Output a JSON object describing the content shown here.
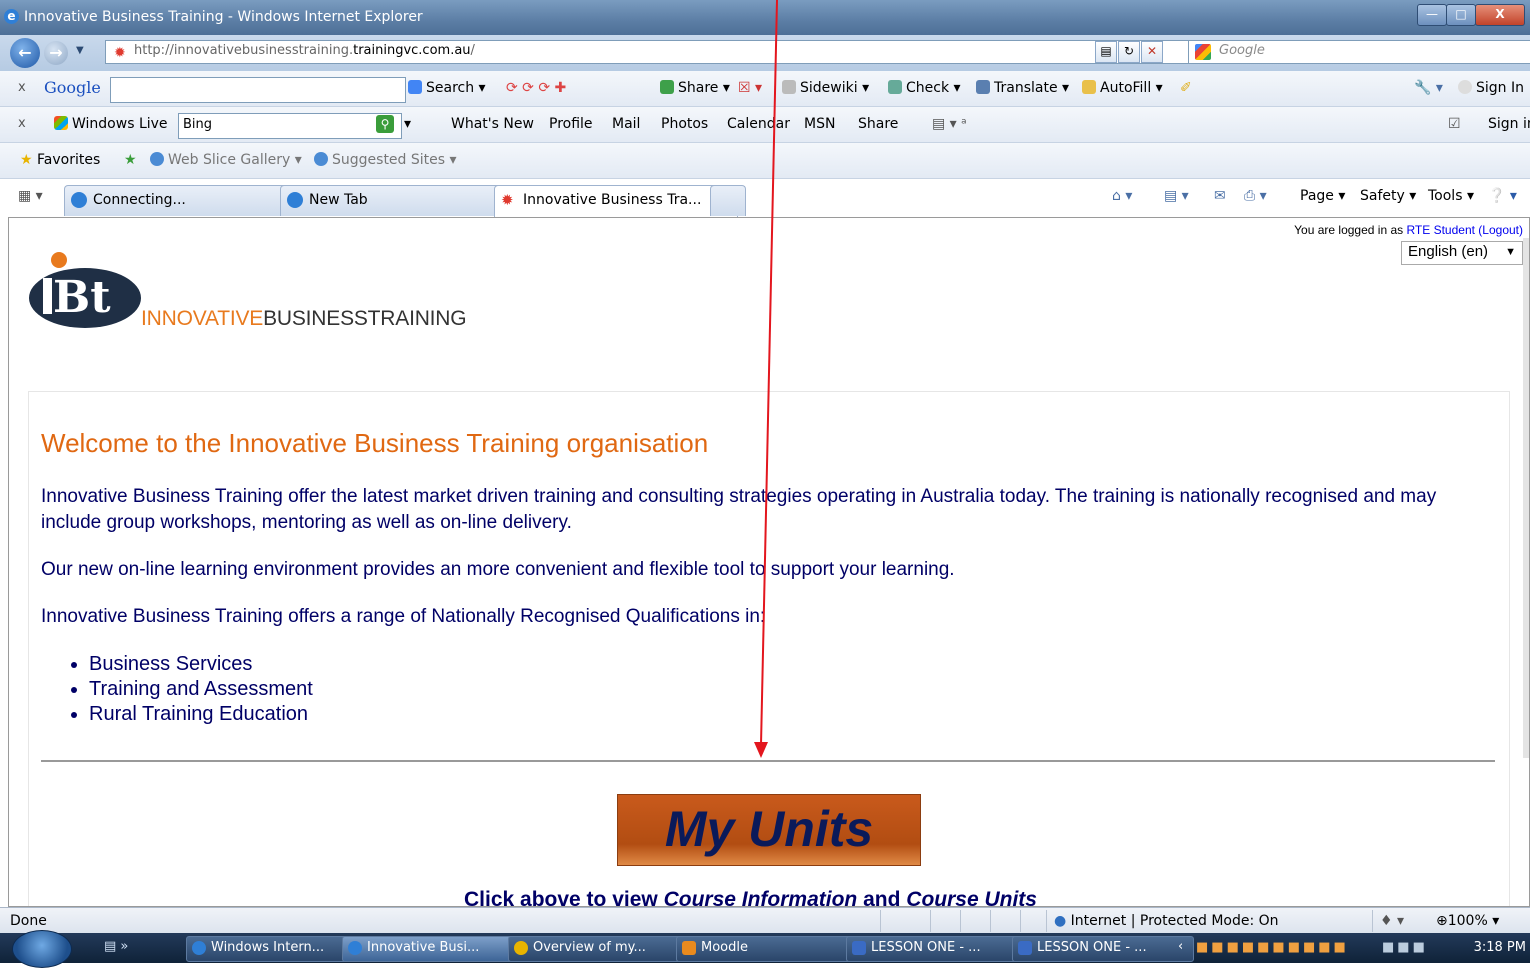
{
  "window": {
    "title": "Innovative Business Training - Windows Internet Explorer"
  },
  "address_bar": {
    "url_prefix": "http://innovativebusinesstraining.",
    "url_domain": "trainingvc.com.au",
    "url_suffix": "/",
    "search_placeholder": "Google"
  },
  "google_toolbar": {
    "close": "x",
    "logo": "Google",
    "search_value": "",
    "search_btn": "Search",
    "share": "Share",
    "sidewiki": "Sidewiki",
    "check": "Check",
    "translate": "Translate",
    "autofill": "AutoFill",
    "sign_in": "Sign In"
  },
  "live_toolbar": {
    "close": "x",
    "brand": "Windows Live",
    "search_value": "Bing",
    "links": [
      "What's New",
      "Profile",
      "Mail",
      "Photos",
      "Calendar",
      "MSN",
      "Share"
    ],
    "sign_in": "Sign in"
  },
  "favorites_bar": {
    "favorites": "Favorites",
    "web_slice": "Web Slice Gallery",
    "suggested": "Suggested Sites"
  },
  "tabs": [
    {
      "label": "Connecting..."
    },
    {
      "label": "New Tab"
    },
    {
      "label": "Innovative Business Tra..."
    }
  ],
  "command_bar": {
    "page": "Page",
    "safety": "Safety",
    "tools": "Tools"
  },
  "page": {
    "login_prefix": "You are logged in as",
    "login_user": "RTE Student",
    "logout": "(Logout)",
    "language": "English (en)",
    "logo_text_orange": "INNOVATIVE",
    "logo_text_dark": "BUSINESSTRAINING",
    "welcome": "Welcome to the Innovative Business Training organisation",
    "para1": "Innovative Business Training offer the latest market driven training and consulting strategies operating in Australia today. The training is nationally recognised and may include group workshops, mentoring as well as on-line delivery.",
    "para2": "Our new on-line learning environment provides an more convenient and flexible tool to support your learning.",
    "para3": "Innovative Business Training offers a range of Nationally Recognised Qualifications in:",
    "qualifications": [
      "Business Services",
      "Training and Assessment",
      "Rural Training Education"
    ],
    "my_units": "My Units",
    "click_note_1": "Click above to view ",
    "click_note_2": "Course Information",
    "click_note_3": " and ",
    "click_note_4": "Course Units"
  },
  "status_bar": {
    "status": "Done",
    "zone": "Internet | Protected Mode: On",
    "zoom": "100%"
  },
  "taskbar": {
    "items": [
      "Windows Intern...",
      "Innovative Busi...",
      "Overview of my...",
      "Moodle",
      "LESSON ONE - ...",
      "LESSON ONE - ..."
    ],
    "clock": "3:18 PM"
  }
}
